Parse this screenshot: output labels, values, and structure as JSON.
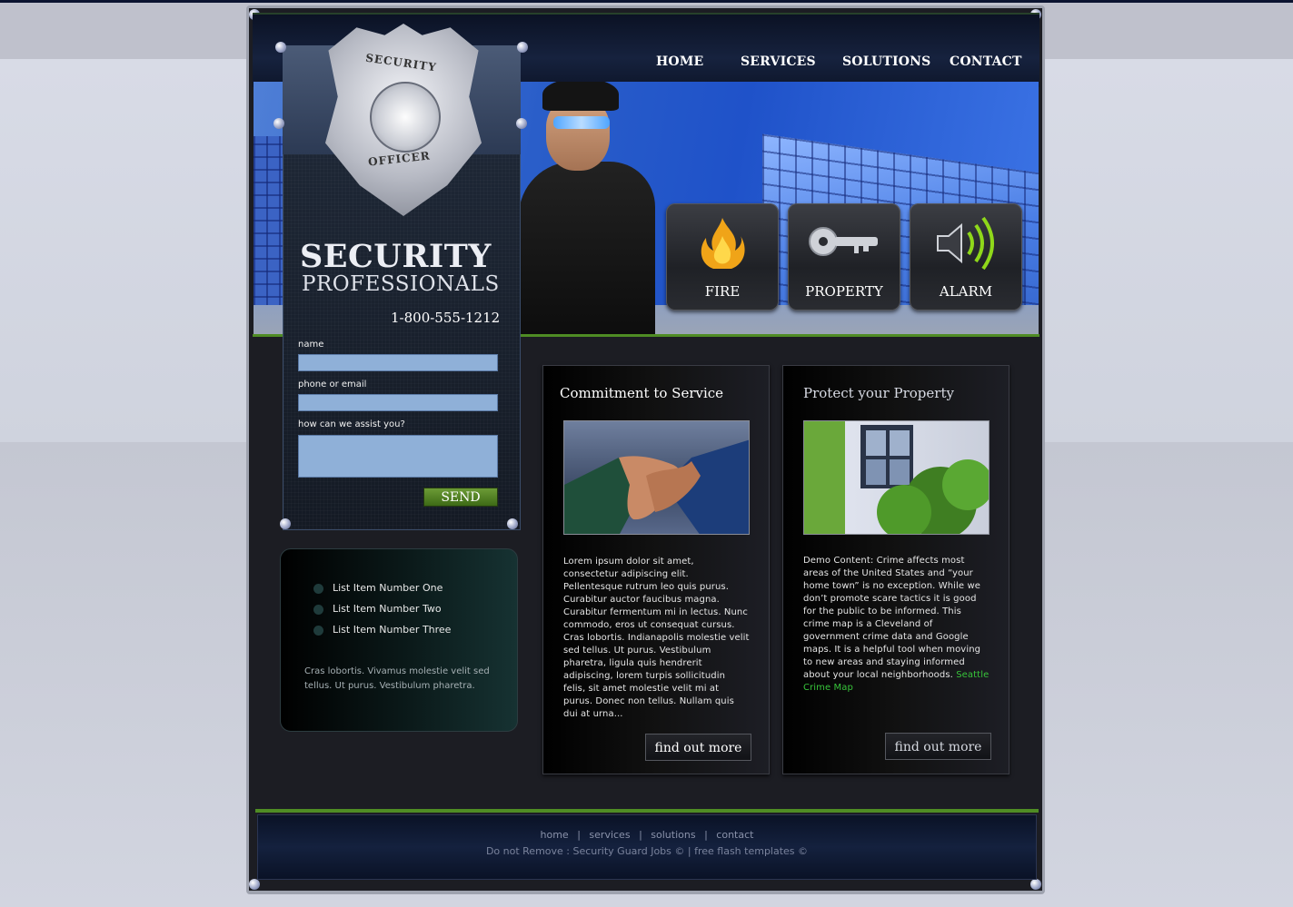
{
  "nav": [
    "HOME",
    "SERVICES",
    "SOLUTIONS",
    "CONTACT"
  ],
  "brand": {
    "title_line1": "SECURITY",
    "title_line2": "PROFESSIONALS",
    "phone": "1-800-555-1212",
    "badge_top": "SECURITY",
    "badge_bottom": "OFFICER"
  },
  "services": [
    {
      "label": "FIRE",
      "icon": "flame-icon"
    },
    {
      "label": "PROPERTY",
      "icon": "key-icon"
    },
    {
      "label": "ALARM",
      "icon": "speaker-icon"
    }
  ],
  "form": {
    "name_label": "name",
    "contact_label": "phone or email",
    "message_label": "how can we assist you?",
    "send_label": "SEND"
  },
  "list": {
    "items": [
      "List Item Number One",
      "List Item Number Two",
      "List Item Number Three"
    ],
    "text": "Cras lobortis. Vivamus molestie velit sed tellus. Ut purus. Vestibulum pharetra."
  },
  "content": [
    {
      "title": "Commitment to Service",
      "text": "Lorem ipsum dolor sit amet, consectetur adipiscing elit. Pellentesque rutrum leo quis purus. Curabitur auctor faucibus magna. Curabitur fermentum mi in lectus. Nunc commodo, eros ut consequat cursus. Cras lobortis. Indianapolis molestie velit sed tellus. Ut purus. Vestibulum pharetra, ligula quis hendrerit adipiscing, lorem turpis sollicitudin felis, sit amet molestie velit mi at purus. Donec non tellus. Nullam quis dui at urna...",
      "button": "find out more"
    },
    {
      "title": "Protect your Property",
      "text": "Demo Content: Crime affects most areas of the United States and “your home town” is no exception. While we don’t promote scare tactics it is good for the public to be informed. This crime map is a Cleveland of government crime data and Google maps. It is a helpful tool when moving to new areas and staying informed about your local neighborhoods.",
      "link": "Seattle Crime Map",
      "button": "find out more"
    }
  ],
  "footer": {
    "links": [
      "home",
      "services",
      "solutions",
      "contact"
    ],
    "separator": "|",
    "copyright": "Do not Remove : Security Guard Jobs © | free flash templates ©"
  },
  "colors": {
    "accent_green": "#4f8c24",
    "link_green": "#37c43a",
    "input_blue": "#8fb0d8"
  }
}
